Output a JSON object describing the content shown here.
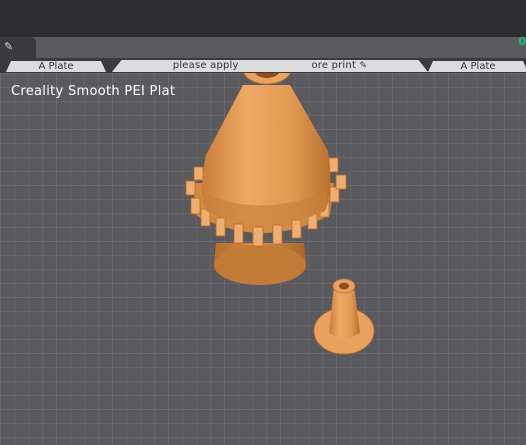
{
  "window": {
    "status_indicator": "0"
  },
  "tabs": {
    "left_plate": "A Plate",
    "center_notice": "please apply",
    "center_notice_tail": "ore print",
    "right_plate": "A Plate"
  },
  "viewport": {
    "plate_name": "Creality Smooth PEI Plat"
  },
  "colors": {
    "model": "#e39a52",
    "grid_bg": "#5a5a5e",
    "grid_line": "#6e6e72",
    "toolbar": "#2d2d31",
    "accent_green": "#12c27a"
  },
  "icons": {
    "edit_tab": "pencil-icon",
    "notice_edit": "pencil-icon"
  }
}
